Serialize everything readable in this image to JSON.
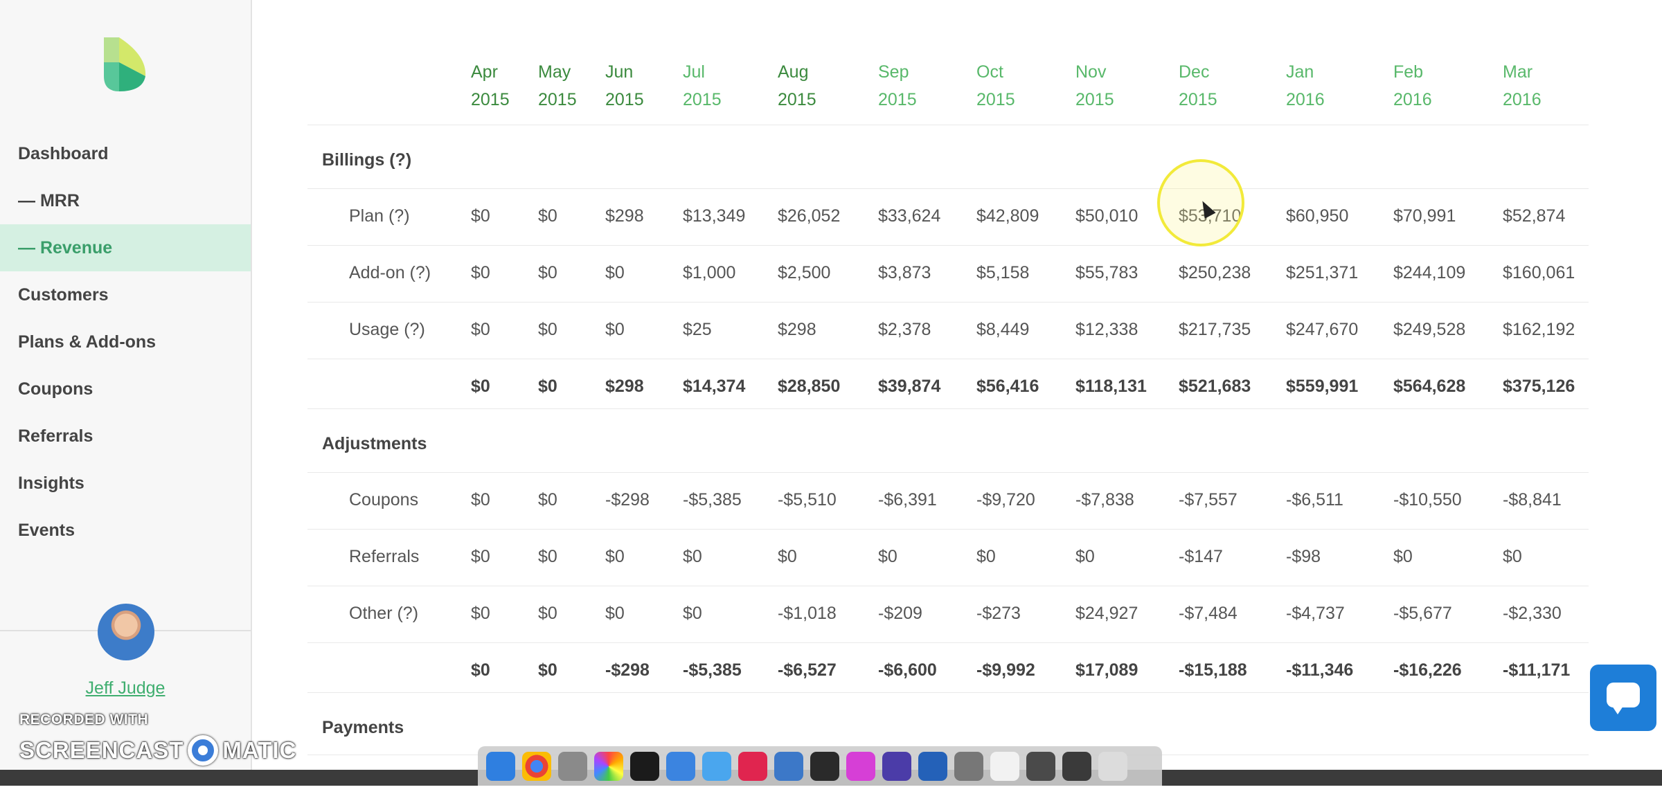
{
  "sidebar": {
    "nav": [
      {
        "label": "Dashboard",
        "active": false
      },
      {
        "label": "— MRR",
        "active": false
      },
      {
        "label": "— Revenue",
        "active": true
      },
      {
        "label": "Customers",
        "active": false
      },
      {
        "label": "Plans & Add-ons",
        "active": false
      },
      {
        "label": "Coupons",
        "active": false
      },
      {
        "label": "Referrals",
        "active": false
      },
      {
        "label": "Insights",
        "active": false
      },
      {
        "label": "Events",
        "active": false
      }
    ],
    "user_name": "Jeff Judge"
  },
  "watermark": {
    "small": "RECORDED WITH",
    "left": "SCREENCAST",
    "right": "MATIC"
  },
  "months": [
    {
      "m": "Apr",
      "y": "2015"
    },
    {
      "m": "May",
      "y": "2015"
    },
    {
      "m": "Jun",
      "y": "2015"
    },
    {
      "m": "Jul",
      "y": "2015"
    },
    {
      "m": "Aug",
      "y": "2015"
    },
    {
      "m": "Sep",
      "y": "2015"
    },
    {
      "m": "Oct",
      "y": "2015"
    },
    {
      "m": "Nov",
      "y": "2015"
    },
    {
      "m": "Dec",
      "y": "2015"
    },
    {
      "m": "Jan",
      "y": "2016"
    },
    {
      "m": "Feb",
      "y": "2016"
    },
    {
      "m": "Mar",
      "y": "2016"
    }
  ],
  "sections": [
    {
      "title": "Billings (?)"
    },
    {
      "title": "Adjustments"
    },
    {
      "title": "Payments"
    }
  ],
  "rows": [
    {
      "label": "Plan (?)",
      "values": [
        "$0",
        "$0",
        "$298",
        "$13,349",
        "$26,052",
        "$33,624",
        "$42,809",
        "$50,010",
        "$53,710",
        "$60,950",
        "$70,991",
        "$52,874"
      ]
    },
    {
      "label": "Add-on (?)",
      "values": [
        "$0",
        "$0",
        "$0",
        "$1,000",
        "$2,500",
        "$3,873",
        "$5,158",
        "$55,783",
        "$250,238",
        "$251,371",
        "$244,109",
        "$160,061"
      ]
    },
    {
      "label": "Usage (?)",
      "values": [
        "$0",
        "$0",
        "$0",
        "$25",
        "$298",
        "$2,378",
        "$8,449",
        "$12,338",
        "$217,735",
        "$247,670",
        "$249,528",
        "$162,192"
      ]
    },
    {
      "label": "",
      "total": true,
      "values": [
        "$0",
        "$0",
        "$298",
        "$14,374",
        "$28,850",
        "$39,874",
        "$56,416",
        "$118,131",
        "$521,683",
        "$559,991",
        "$564,628",
        "$375,126"
      ]
    },
    {
      "label": "Coupons",
      "values": [
        "$0",
        "$0",
        "-$298",
        "-$5,385",
        "-$5,510",
        "-$6,391",
        "-$9,720",
        "-$7,838",
        "-$7,557",
        "-$6,511",
        "-$10,550",
        "-$8,841"
      ]
    },
    {
      "label": "Referrals",
      "values": [
        "$0",
        "$0",
        "$0",
        "$0",
        "$0",
        "$0",
        "$0",
        "$0",
        "-$147",
        "-$98",
        "$0",
        "$0"
      ]
    },
    {
      "label": "Other (?)",
      "values": [
        "$0",
        "$0",
        "$0",
        "$0",
        "-$1,018",
        "-$209",
        "-$273",
        "$24,927",
        "-$7,484",
        "-$4,737",
        "-$5,677",
        "-$2,330"
      ]
    },
    {
      "label": "",
      "total": true,
      "values": [
        "$0",
        "$0",
        "-$298",
        "-$5,385",
        "-$6,527",
        "-$6,600",
        "-$9,992",
        "$17,089",
        "-$15,188",
        "-$11,346",
        "-$16,226",
        "-$11,171"
      ]
    }
  ],
  "colors": {
    "accent": "#3fae6f",
    "month_dark": "#3b8a3e",
    "month_light": "#58b86a",
    "active_bg": "#d5f0e2",
    "chat": "#1e7ed8"
  }
}
